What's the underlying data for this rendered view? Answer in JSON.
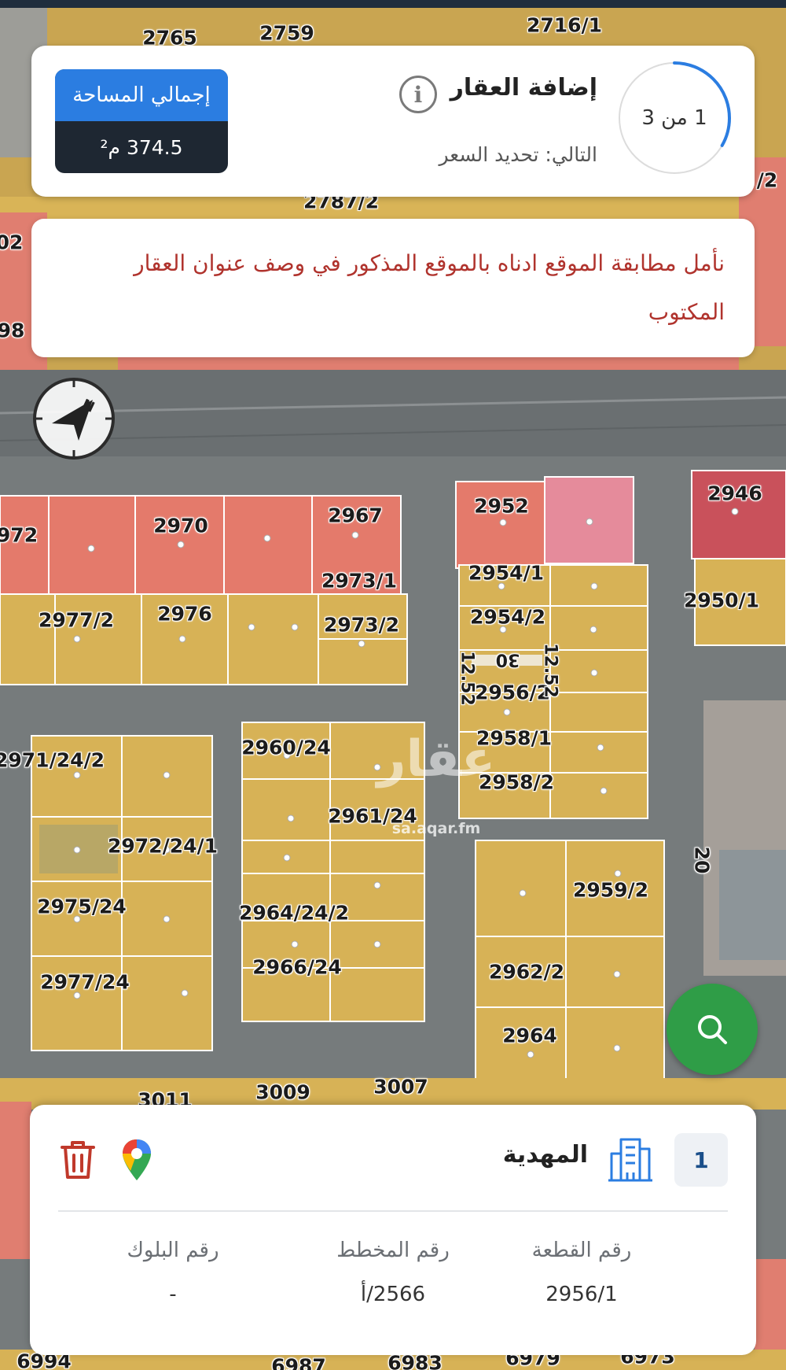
{
  "header": {
    "step_text": "1 من 3",
    "step_progress": 0.333,
    "title": "إضافة العقار",
    "next_step": "التالي: تحديد السعر",
    "area_label": "إجمالي المساحة",
    "area_value": "374.5 م²"
  },
  "notice": {
    "text": "نأمل مطابقة الموقع ادناه بالموقع المذكور في وصف عنوان العقار المكتوب"
  },
  "map": {
    "watermark": "عقار",
    "watermark_sub": "sa.aqar.fm",
    "compass_letter": "N",
    "street_width": "20",
    "lane_label": "30",
    "lane_width_1": "12.52",
    "lane_width_2": "12.52",
    "plots": [
      "2765",
      "2759",
      "2716/1",
      "2787/2",
      "/2",
      "02",
      "98",
      "2952",
      "2946",
      "2970",
      "2967",
      "972",
      "2973/1",
      "2954/1",
      "2950/1",
      "2977/2",
      "2976",
      "2973/2",
      "2954/2",
      "2956/2",
      "2958/1",
      "2958/2",
      "2971/24/2",
      "2960/24",
      "2961/24",
      "2972/24/1",
      "2959/2",
      "2975/24",
      "2964/24/2",
      "2966/24",
      "2962/2",
      "2977/24",
      "2964",
      "3011",
      "3009",
      "3007",
      "6994",
      "6987",
      "6983",
      "6979",
      "6973"
    ]
  },
  "property": {
    "index": "1",
    "district": "المهدية",
    "fields": [
      {
        "label": "رقم القطعة",
        "value": "2956/1"
      },
      {
        "label": "رقم المخطط",
        "value": "2566/أ"
      },
      {
        "label": "رقم البلوك",
        "value": "-"
      }
    ]
  },
  "colors": {
    "accent": "#2b7de1",
    "notice": "#b0332d",
    "fab": "#2f9d47",
    "area_box": "#1e2732"
  }
}
